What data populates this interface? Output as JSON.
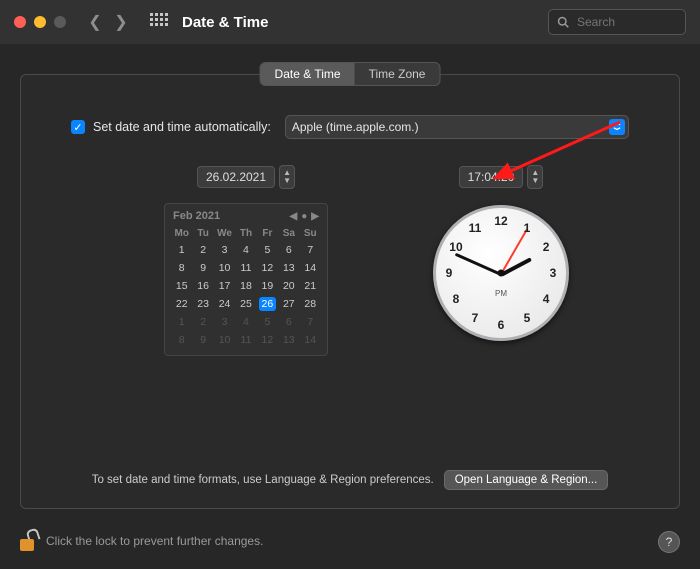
{
  "titlebar": {
    "title": "Date & Time",
    "search_placeholder": "Search"
  },
  "tabs": {
    "date_time": "Date & Time",
    "time_zone": "Time Zone"
  },
  "auto": {
    "label": "Set date and time automatically:",
    "server": "Apple (time.apple.com.)"
  },
  "date_field": "26.02.2021",
  "time_field": "17:04:20",
  "calendar": {
    "month": "Feb 2021",
    "dow": [
      "Mo",
      "Tu",
      "We",
      "Th",
      "Fr",
      "Sa",
      "Su"
    ],
    "rows": [
      [
        {
          "d": "1"
        },
        {
          "d": "2"
        },
        {
          "d": "3"
        },
        {
          "d": "4"
        },
        {
          "d": "5"
        },
        {
          "d": "6"
        },
        {
          "d": "7"
        }
      ],
      [
        {
          "d": "8"
        },
        {
          "d": "9"
        },
        {
          "d": "10"
        },
        {
          "d": "11"
        },
        {
          "d": "12"
        },
        {
          "d": "13"
        },
        {
          "d": "14"
        }
      ],
      [
        {
          "d": "15"
        },
        {
          "d": "16"
        },
        {
          "d": "17"
        },
        {
          "d": "18"
        },
        {
          "d": "19"
        },
        {
          "d": "20"
        },
        {
          "d": "21"
        }
      ],
      [
        {
          "d": "22"
        },
        {
          "d": "23"
        },
        {
          "d": "24"
        },
        {
          "d": "25"
        },
        {
          "d": "26",
          "sel": true
        },
        {
          "d": "27"
        },
        {
          "d": "28"
        }
      ],
      [
        {
          "d": "1",
          "dim": true
        },
        {
          "d": "2",
          "dim": true
        },
        {
          "d": "3",
          "dim": true
        },
        {
          "d": "4",
          "dim": true
        },
        {
          "d": "5",
          "dim": true
        },
        {
          "d": "6",
          "dim": true
        },
        {
          "d": "7",
          "dim": true
        }
      ],
      [
        {
          "d": "8",
          "dim": true
        },
        {
          "d": "9",
          "dim": true
        },
        {
          "d": "10",
          "dim": true
        },
        {
          "d": "11",
          "dim": true
        },
        {
          "d": "12",
          "dim": true
        },
        {
          "d": "13",
          "dim": true
        },
        {
          "d": "14",
          "dim": true
        }
      ]
    ]
  },
  "clock": {
    "ampm": "PM",
    "numbers": [
      "12",
      "1",
      "2",
      "3",
      "4",
      "5",
      "6",
      "7",
      "8",
      "9",
      "10",
      "11"
    ],
    "hour_angle": 62,
    "min_angle": -66,
    "sec_angle": 30
  },
  "footer": {
    "hint": "To set date and time formats, use Language & Region preferences.",
    "button": "Open Language & Region..."
  },
  "lock_hint": "Click the lock to prevent further changes.",
  "help": "?"
}
